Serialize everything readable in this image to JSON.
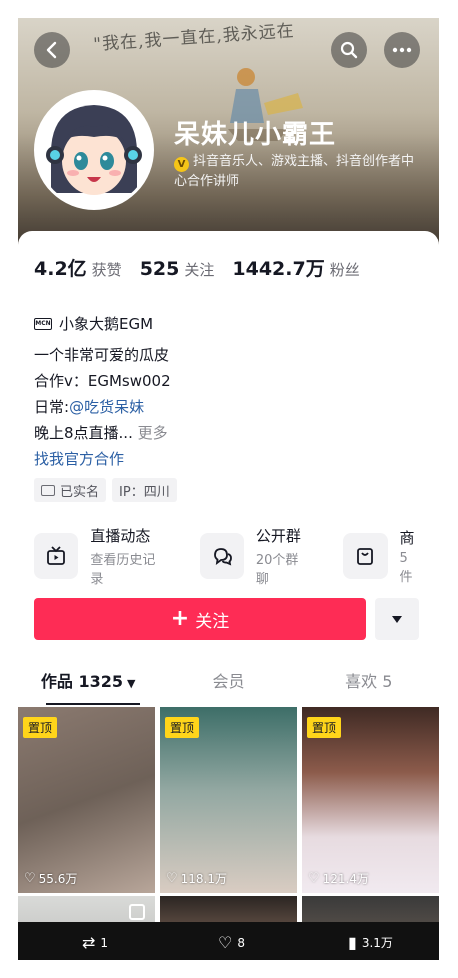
{
  "header": {
    "cover_sketch_text": "\"我在,我一直在,我永远在",
    "name": "呆妹儿小霸王",
    "verification": "抖音音乐人、游戏主播、抖音创作者中心合作讲师"
  },
  "stats": [
    {
      "value": "4.2亿",
      "label": "获赞"
    },
    {
      "value": "525",
      "label": "关注"
    },
    {
      "value": "1442.7万",
      "label": "粉丝"
    }
  ],
  "mcn": {
    "badge": "MCN",
    "name": "小象大鹅EGM"
  },
  "bio": {
    "line1": "一个非常可爱的瓜皮",
    "line2": "合作v：EGMsw002",
    "line3_prefix": "日常:",
    "line3_link": "@吃货呆妹",
    "line4": "晚上8点直播...",
    "more": "更多",
    "official": "找我官方合作"
  },
  "tags": {
    "realname": "已实名",
    "ip": "IP：四川"
  },
  "features": [
    {
      "title": "直播动态",
      "sub": "查看历史记录",
      "icon": "tv-icon"
    },
    {
      "title": "公开群",
      "sub": "20个群聊",
      "icon": "chat-icon"
    },
    {
      "title": "商",
      "sub": "5件",
      "icon": "shop-icon"
    }
  ],
  "follow_label": "关注",
  "tabs": [
    {
      "label": "作品 1325"
    },
    {
      "label": "会员"
    },
    {
      "label": "喜欢 5"
    }
  ],
  "videos": [
    {
      "pinned": "置顶",
      "likes": "55.6万"
    },
    {
      "pinned": "置顶",
      "likes": "118.1万"
    },
    {
      "pinned": "置顶",
      "likes": "121.4万"
    }
  ],
  "bottom_bar": {
    "reposts": "1",
    "likes": "8",
    "views": "3.1万"
  },
  "colors": {
    "accent": "#fe2c55",
    "pin": "#ffd51a",
    "link": "#2b5fa4"
  }
}
